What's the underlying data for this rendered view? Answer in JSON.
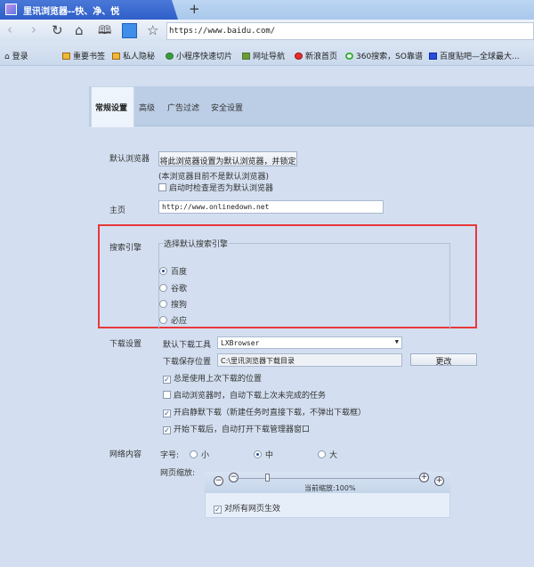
{
  "browser": {
    "tab_title": "里讯浏览器--快、净、悦",
    "new_tab": "+",
    "url": "https://www.baidu.com/",
    "nav_icons": [
      "back-icon",
      "forward-icon",
      "refresh-icon",
      "home-icon",
      "reader-icon",
      "qr-icon",
      "star-icon"
    ]
  },
  "bookmarks": {
    "login": "登录",
    "items": [
      "重要书签",
      "私人隐秘",
      "小程序快速切片",
      "网址导航",
      "新浪首页",
      "360搜索，SO靠谱",
      "百度贴吧—全球最大..."
    ]
  },
  "settings": {
    "tabs": [
      "常规设置",
      "高级",
      "广告过滤",
      "安全设置"
    ],
    "active_tab": "常规设置",
    "default_browser": {
      "label": "默认浏览器",
      "button": "将此浏览器设置为默认浏览器，并锁定",
      "status": "(本浏览器目前不是默认浏览器)",
      "check_on_start": "启动时检查是否为默认浏览器",
      "check_on_start_checked": false
    },
    "homepage": {
      "label": "主页",
      "value": "http://www.onlinedown.net"
    },
    "search": {
      "label": "搜索引擎",
      "group_title": "选择默认搜索引擎",
      "options": [
        "百度",
        "谷歌",
        "搜狗",
        "必应"
      ],
      "selected": "百度"
    },
    "download": {
      "label": "下载设置",
      "tool_label": "默认下载工具",
      "tool_value": "LXBrowser",
      "path_label": "下载保存位置",
      "path_value": "C:\\里讯浏览器下载目录",
      "change_button": "更改",
      "options": [
        {
          "text": "总是使用上次下载的位置",
          "checked": true
        },
        {
          "text": "启动浏览器时，自动下载上次未完成的任务",
          "checked": false
        },
        {
          "text": "开启静默下载（新建任务时直接下载，不弹出下载框）",
          "checked": true
        },
        {
          "text": "开始下载后，自动打开下载管理器窗口",
          "checked": true
        }
      ]
    },
    "web_content": {
      "label": "网络内容",
      "font_size_label": "字号:",
      "font_sizes": [
        "小",
        "中",
        "大"
      ],
      "font_size_selected": "中",
      "zoom_label": "网页缩放:",
      "zoom_text": "当前缩放:100%",
      "zoom_percent": 100,
      "apply_all": "对所有网页生效",
      "apply_all_checked": true
    }
  },
  "colors": {
    "highlight_border": "#e8373a",
    "tab_active": "#2f5fc8"
  }
}
